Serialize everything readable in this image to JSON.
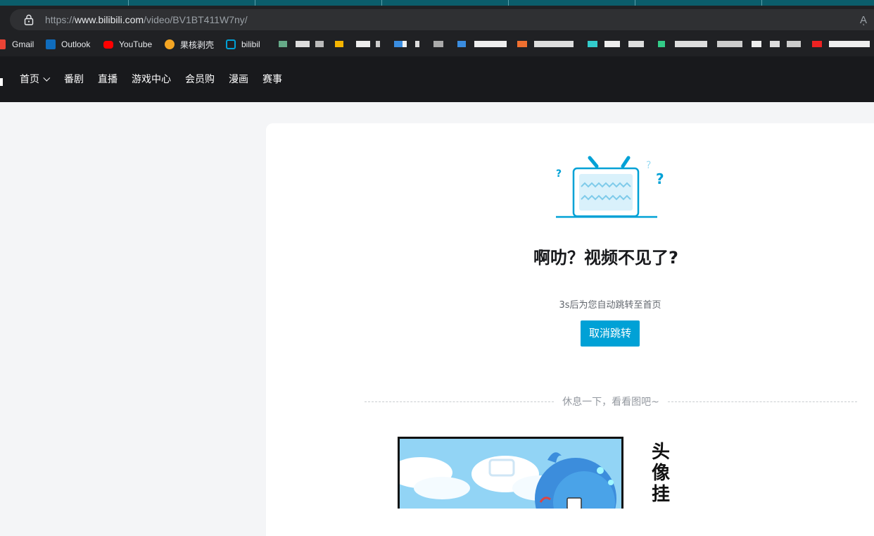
{
  "browser": {
    "url_scheme": "https://",
    "url_host": "www.bilibili.com",
    "url_path": "/video/BV1BT411W7ny/",
    "read_aloud_glyph": "Aͅ"
  },
  "bookmarks": [
    {
      "label": "Gmail",
      "icon": "gmail-icon",
      "color": "#ea4335"
    },
    {
      "label": "Outlook",
      "icon": "outlook-icon",
      "color": "#0f6cbd"
    },
    {
      "label": "YouTube",
      "icon": "youtube-icon",
      "color": "#ff0000"
    },
    {
      "label": "果核剥壳",
      "icon": "orange-icon",
      "color": "#f5a623"
    },
    {
      "label": "bilibili",
      "icon": "bilibili-icon",
      "color": "#00a1d6"
    }
  ],
  "nav": {
    "home": "首页",
    "anime": "番剧",
    "live": "直播",
    "game_center": "游戏中心",
    "vip_shop": "会员购",
    "manga": "漫画",
    "esports": "赛事"
  },
  "error": {
    "title": "啊叻？视频不见了?",
    "redirect_text": "3s后为您自动跳转至首页",
    "cancel_button": "取消跳转",
    "divider_text": "休息一下，看看图吧~",
    "comic_side_text": "头像挂"
  },
  "colors": {
    "accent": "#00a1d6",
    "header_bg": "#18191c",
    "page_bg": "#f4f5f7"
  }
}
